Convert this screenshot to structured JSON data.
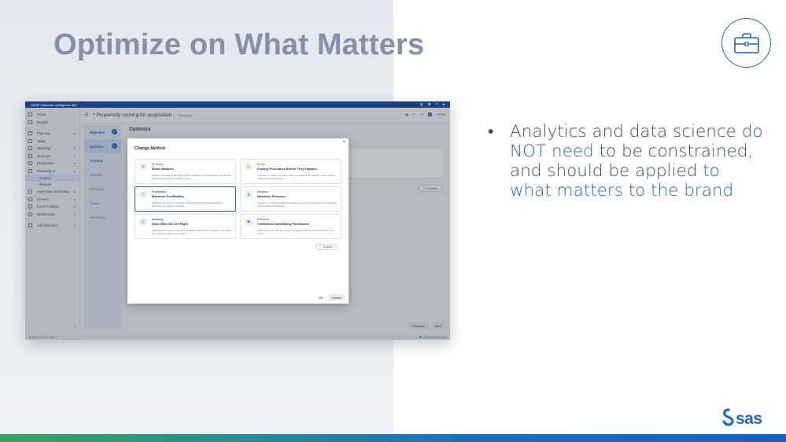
{
  "slide": {
    "title": "Optimize on What Matters",
    "bullet_dot": "•",
    "bullet_parts": [
      {
        "text": "Analytics and data science ",
        "highlight": false
      },
      {
        "text": "do NOT need",
        "highlight": true
      },
      {
        "text": " to be constrained, and should be applied ",
        "highlight": false
      },
      {
        "text": "to what matters to the brand",
        "highlight": true
      }
    ],
    "logo_text": "Ssas",
    "brand_icon": "briefcase-icon",
    "colors": {
      "accent": "#1d67c2",
      "title": "#8591a6",
      "body": "#3e4c66"
    }
  },
  "app": {
    "window_title": "SAS® Customer Intelligence 360",
    "project_title": "* Propensity scoring for acquisition",
    "project_status": "Designing",
    "head_badge": "1",
    "close_label": "Close",
    "page_title": "Optimize",
    "nav": [
      {
        "label": "Home",
        "chevron": false,
        "sub": false,
        "active": false
      },
      {
        "label": "Insights",
        "chevron": false,
        "sub": false,
        "active": false
      },
      {
        "label": "Planning",
        "chevron": true,
        "sub": false,
        "active": false
      },
      {
        "label": "Tasks",
        "chevron": false,
        "sub": false,
        "active": false
      },
      {
        "label": "Targeting",
        "chevron": true,
        "sub": false,
        "active": false
      },
      {
        "label": "Journeys",
        "chevron": true,
        "sub": false,
        "active": false
      },
      {
        "label": "Decisioning",
        "chevron": true,
        "sub": false,
        "active": false
      },
      {
        "label": "Marketing AI",
        "chevron": true,
        "sub": false,
        "active": false
      },
      {
        "label": "Projects",
        "chevron": false,
        "sub": true,
        "active": true
      },
      {
        "label": "Recipes",
        "chevron": false,
        "sub": true,
        "active": false
      },
      {
        "label": "Application Screening",
        "chevron": true,
        "sub": false,
        "active": false
      },
      {
        "label": "Content",
        "chevron": true,
        "sub": false,
        "active": false
      },
      {
        "label": "Event Tracking",
        "chevron": true,
        "sub": false,
        "active": false
      },
      {
        "label": "Optimization",
        "chevron": true,
        "sub": false,
        "active": false
      },
      {
        "label": "Administration",
        "chevron": true,
        "sub": false,
        "active": false
      }
    ],
    "steps": [
      {
        "label": "Objective",
        "state": "done"
      },
      {
        "label": "Optimize",
        "state": "current"
      },
      {
        "label": "Training",
        "state": "active"
      },
      {
        "label": "Eligibility",
        "state": "todo"
      },
      {
        "label": "Schedule",
        "state": "todo"
      },
      {
        "label": "Output",
        "state": "todo"
      },
      {
        "label": "Monitoring",
        "state": "todo"
      }
    ],
    "explain_label": "Explain",
    "previous_label": "Previous",
    "next_label": "Next",
    "footer_left": "Tenant: Mock Tenant 1",
    "footer_right": "Advanced Security"
  },
  "modal": {
    "title": "Change Method",
    "close": "×",
    "cards": [
      {
        "category": "F1 Score",
        "title": "Model Balance",
        "desc": "Balance accurately identifying likely purchasers and avoiding unnecessary actions toward those unlikely to buy.",
        "color": "#c2367a",
        "bg": "#f9e3ee",
        "icon": "⚖",
        "selected": false
      },
      {
        "category": "Recall",
        "title": "Finding Purchases Before They Happen",
        "desc": "Optimize to capture as many likely purchasers as possible, even if some might not end up buying.",
        "color": "#d0702a",
        "bg": "#fbebdc",
        "icon": "◎",
        "selected": false
      },
      {
        "category": "Profitability",
        "title": "Maximize Profitability",
        "desc": "Optimize the model so that the actions aimed at driving purchases generate the highest net profit.",
        "color": "#2b8a5a",
        "bg": "#dcf1e6",
        "icon": "↗",
        "selected": true
      },
      {
        "category": "Revenue",
        "title": "Maximize Revenue",
        "desc": "Optimize to drive the highest total revenue by securing as many purchase opportunities as possible.",
        "color": "#2b8a5a",
        "bg": "#dcf1e6",
        "icon": "$",
        "selected": false
      },
      {
        "category": "Accuracy",
        "title": "How Often We Are Right",
        "desc": "Optimize the model so that the predictions about who is likely to purchase are correct as often as possible.",
        "color": "#1d5ec1",
        "bg": "#dde8f8",
        "icon": "✓",
        "selected": false
      },
      {
        "category": "Precision",
        "title": "Confidence Identifying Purchasers",
        "desc": "Optimize to act only when there is high confidence that a purchase will occur.",
        "color": "#7b4bc2",
        "bg": "#ebe2f8",
        "icon": "◆",
        "selected": false
      }
    ],
    "explain_label": "Explain",
    "ok_label": "OK",
    "cancel_label": "Cancel"
  }
}
